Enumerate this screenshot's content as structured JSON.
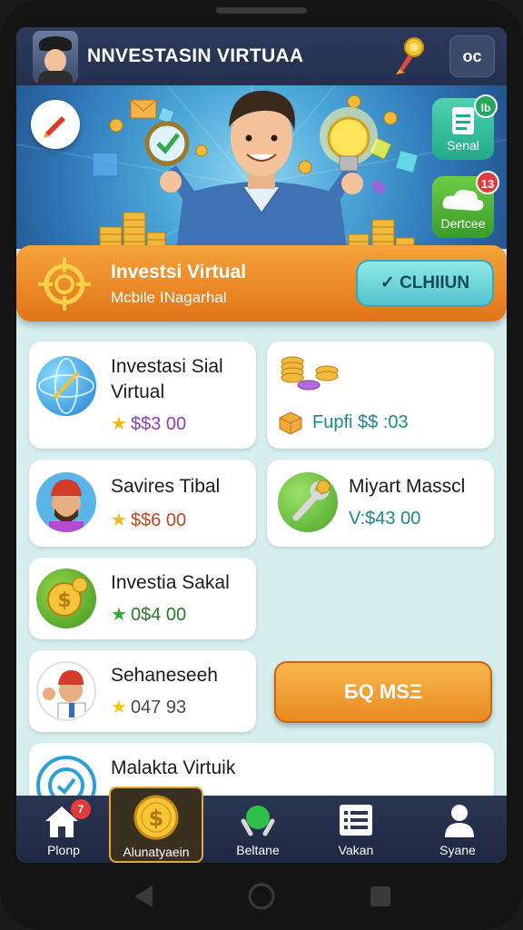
{
  "header": {
    "title": "NNVESTASIN VIRTUAA",
    "menu_label": "oc"
  },
  "hero": {
    "side_cards": [
      {
        "label": "Senal",
        "badge": "lb"
      },
      {
        "label": "Dertcee",
        "badge": "13"
      }
    ]
  },
  "banner": {
    "title": "Investsi Virtual",
    "subtitle": "Mcbile INagarhal",
    "button": "✓ CLHIIUN"
  },
  "cards": [
    {
      "title": "Investasi Sial Virtual",
      "price": "$$3 00"
    },
    {
      "title": "",
      "price": "Fupfi $$ :03"
    },
    {
      "title": "Savires Tibal",
      "price": "$$6 00"
    },
    {
      "title": "Miyart Masscl",
      "price": "V:$43 00"
    },
    {
      "title": "Investia Sakal",
      "price": "0$4 00"
    },
    {
      "title": "Sehaneseeh",
      "price": "047 93"
    },
    {
      "title": "Malakta Virtuik",
      "price": ""
    }
  ],
  "buy_button": "БQ MSΞ",
  "nav": [
    {
      "label": "Plonp",
      "badge": "7"
    },
    {
      "label": "Alunatyaein"
    },
    {
      "label": "Beltane"
    },
    {
      "label": "Vakan"
    },
    {
      "label": "Syane"
    }
  ],
  "colors": {
    "accent_orange": "#e98a1f",
    "navbar": "#2b3653",
    "background": "#d6efee",
    "teal": "#52c4cc"
  }
}
